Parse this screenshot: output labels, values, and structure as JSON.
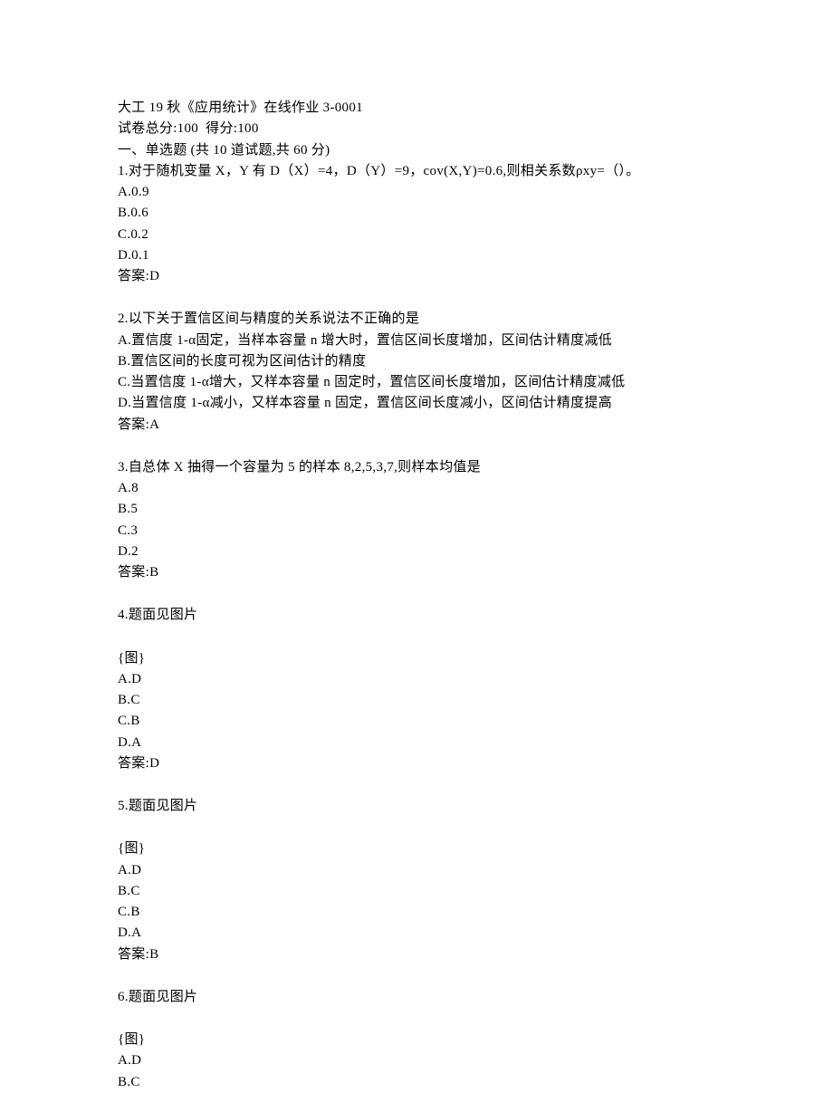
{
  "header": {
    "title": "大工 19 秋《应用统计》在线作业 3-0001",
    "score_line": "试卷总分:100  得分:100",
    "section_header": "一、单选题 (共 10 道试题,共 60 分)"
  },
  "questions": [
    {
      "stem": "1.对于随机变量 X，Y 有 D（X）=4，D（Y）=9，cov(X,Y)=0.6,则相关系数ρxy=（）。",
      "options": [
        "A.0.9",
        "B.0.6",
        "C.0.2",
        "D.0.1"
      ],
      "answer": "答案:D"
    },
    {
      "stem": "2.以下关于置信区间与精度的关系说法不正确的是",
      "options": [
        "A.置信度 1-α固定，当样本容量 n 增大时，置信区间长度增加，区间估计精度减低",
        "B.置信区间的长度可视为区间估计的精度",
        "C.当置信度 1-α增大，又样本容量 n 固定时，置信区间长度增加，区间估计精度减低",
        "D.当置信度 1-α减小，又样本容量 n 固定，置信区间长度减小，区间估计精度提高"
      ],
      "answer": "答案:A"
    },
    {
      "stem": "3.自总体 X 抽得一个容量为 5 的样本 8,2,5,3,7,则样本均值是",
      "options": [
        "A.8",
        "B.5",
        "C.3",
        "D.2"
      ],
      "answer": "答案:B"
    },
    {
      "stem": "4.题面见图片",
      "placeholder": "{图}",
      "options": [
        "A.D",
        "B.C",
        "C.B",
        "D.A"
      ],
      "answer": "答案:D"
    },
    {
      "stem": "5.题面见图片",
      "placeholder": "{图}",
      "options": [
        "A.D",
        "B.C",
        "C.B",
        "D.A"
      ],
      "answer": "答案:B"
    },
    {
      "stem": "6.题面见图片",
      "placeholder": "{图}",
      "options": [
        "A.D",
        "B.C"
      ],
      "answer": null
    }
  ]
}
